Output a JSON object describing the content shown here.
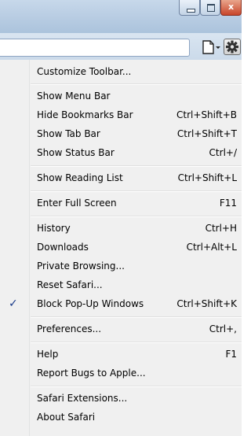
{
  "window": {
    "minimize_glyph": "",
    "maximize_glyph": "",
    "close_glyph": "x"
  },
  "menu": {
    "items": [
      {
        "label": "Customize Toolbar...",
        "shortcut": ""
      },
      {
        "label": "Show Menu Bar",
        "shortcut": ""
      },
      {
        "label": "Hide Bookmarks Bar",
        "shortcut": "Ctrl+Shift+B"
      },
      {
        "label": "Show Tab Bar",
        "shortcut": "Ctrl+Shift+T"
      },
      {
        "label": "Show Status Bar",
        "shortcut": "Ctrl+/"
      },
      {
        "label": "Show Reading List",
        "shortcut": "Ctrl+Shift+L"
      },
      {
        "label": "Enter Full Screen",
        "shortcut": "F11"
      },
      {
        "label": "History",
        "shortcut": "Ctrl+H"
      },
      {
        "label": "Downloads",
        "shortcut": "Ctrl+Alt+L"
      },
      {
        "label": "Private Browsing...",
        "shortcut": ""
      },
      {
        "label": "Reset Safari...",
        "shortcut": ""
      },
      {
        "label": "Block Pop-Up Windows",
        "shortcut": "Ctrl+Shift+K",
        "checked": true,
        "check_glyph": "✓"
      },
      {
        "label": "Preferences...",
        "shortcut": "Ctrl+,"
      },
      {
        "label": "Help",
        "shortcut": "F1"
      },
      {
        "label": "Report Bugs to Apple...",
        "shortcut": ""
      },
      {
        "label": "Safari Extensions...",
        "shortcut": ""
      },
      {
        "label": "About Safari",
        "shortcut": ""
      }
    ]
  },
  "colors": {
    "menu_background": "#f0f0f0",
    "titlebar": "#b9cde3",
    "close_button": "#c8462a",
    "checkmark": "#1a3b8a"
  },
  "icons": {
    "page_menu": "page-icon",
    "settings_menu": "gear-icon"
  }
}
